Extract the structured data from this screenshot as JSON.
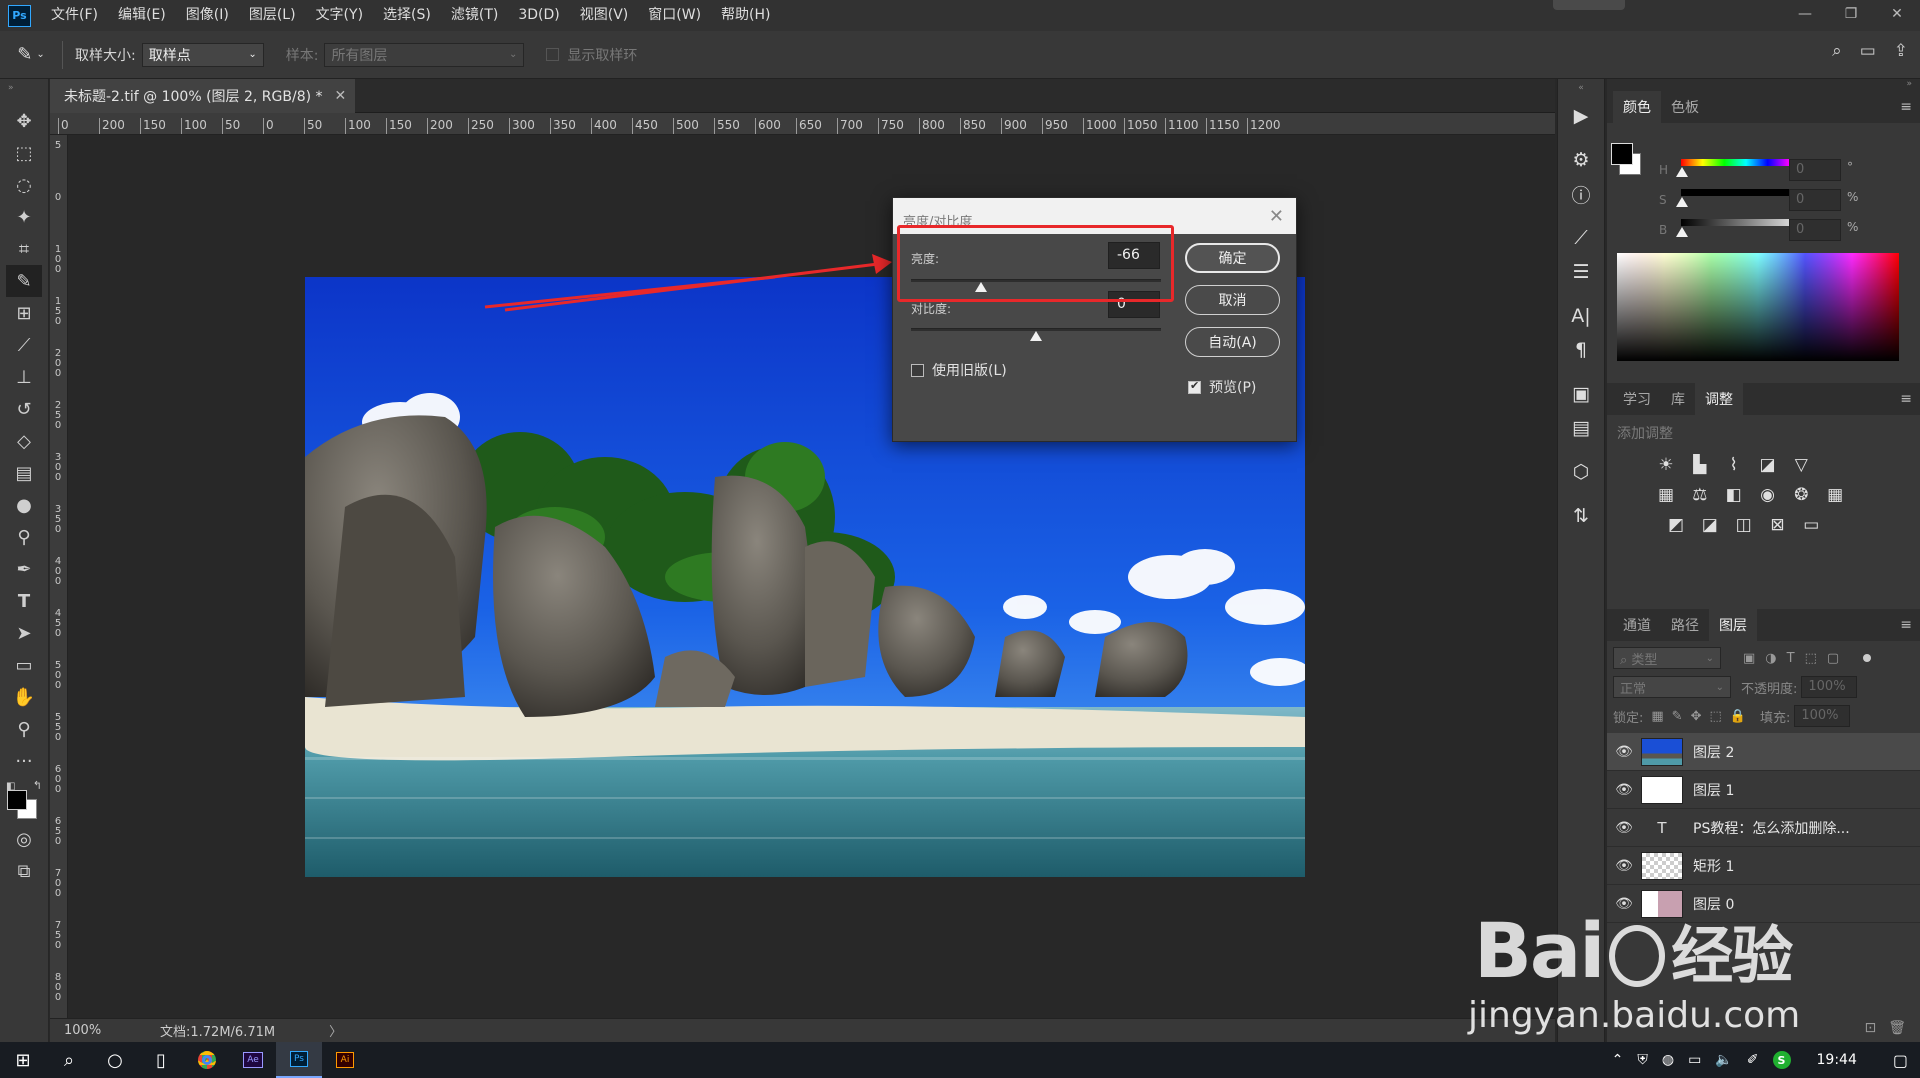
{
  "app": {
    "logo": "Ps"
  },
  "menu": [
    "文件(F)",
    "编辑(E)",
    "图像(I)",
    "图层(L)",
    "文字(Y)",
    "选择(S)",
    "滤镜(T)",
    "3D(D)",
    "视图(V)",
    "窗口(W)",
    "帮助(H)"
  ],
  "window_controls": {
    "minimize": "—",
    "restore": "❐",
    "close": "✕"
  },
  "options": {
    "sample_size_label": "取样大小:",
    "sample_size_value": "取样点",
    "sample_label": "样本:",
    "sample_value": "所有图层",
    "show_ring_label": "显示取样环"
  },
  "document": {
    "tab_title": "未标题-2.tif @ 100% (图层 2, RGB/8) *",
    "ruler_h": [
      "0",
      "200",
      "150",
      "100",
      "50",
      "0",
      "50",
      "100",
      "150",
      "200",
      "250",
      "300",
      "350",
      "400",
      "450",
      "500",
      "550",
      "600",
      "650",
      "700",
      "750",
      "800",
      "850",
      "900",
      "950",
      "1000",
      "1050",
      "1100",
      "1150",
      "1200"
    ],
    "ruler_v": [
      "5",
      "0",
      "1 0 0",
      "1 5 0",
      "2 0 0",
      "2 5 0",
      "3 0 0",
      "3 5 0",
      "4 0 0",
      "4 5 0",
      "5 0 0",
      "5 5 0",
      "6 0 0",
      "6 5 0",
      "7 0 0",
      "7 5 0",
      "8 0 0"
    ],
    "zoom": "100%",
    "doc_size": "文档:1.72M/6.71M",
    "status_arrow": "〉"
  },
  "dialog": {
    "title": "亮度/对比度",
    "brightness_label": "亮度:",
    "brightness_value": "-66",
    "brightness_level": -66,
    "contrast_label": "对比度:",
    "contrast_value": "0",
    "contrast_level": 0,
    "ok": "确定",
    "cancel": "取消",
    "auto": "自动(A)",
    "legacy": "使用旧版(L)",
    "legacy_checked": false,
    "preview": "预览(P)",
    "preview_checked": true
  },
  "color_panel": {
    "tabs": [
      "颜色",
      "色板"
    ],
    "h_label": "H",
    "h_value": "0",
    "h_unit": "°",
    "s_label": "S",
    "s_value": "0",
    "s_unit": "%",
    "b_label": "B",
    "b_value": "0",
    "b_unit": "%"
  },
  "adjust_panel": {
    "tabs": [
      "学习",
      "库",
      "调整"
    ],
    "add_label": "添加调整"
  },
  "layers_panel": {
    "tabs": [
      "通道",
      "路径",
      "图层"
    ],
    "filter_placeholder": "类型",
    "blend_mode": "正常",
    "opacity_label": "不透明度:",
    "opacity_value": "100%",
    "lock_label": "锁定:",
    "fill_label": "填充:",
    "fill_value": "100%",
    "layers": [
      {
        "name": "图层 2",
        "type": "image",
        "selected": true
      },
      {
        "name": "图层 1",
        "type": "white",
        "selected": false
      },
      {
        "name": "PS教程：怎么添加删除...",
        "type": "text",
        "selected": false
      },
      {
        "name": "矩形 1",
        "type": "shape",
        "selected": false
      },
      {
        "name": "图层 0",
        "type": "image",
        "selected": false
      }
    ]
  },
  "taskbar": {
    "time": "19:44",
    "lang": "S"
  },
  "watermark": {
    "brand": "Bai",
    "brand_cn": "经验",
    "url": "jingyan.baidu.com"
  },
  "colors": {
    "accent_red": "#e8282a",
    "ps_blue": "#31a8ff"
  }
}
